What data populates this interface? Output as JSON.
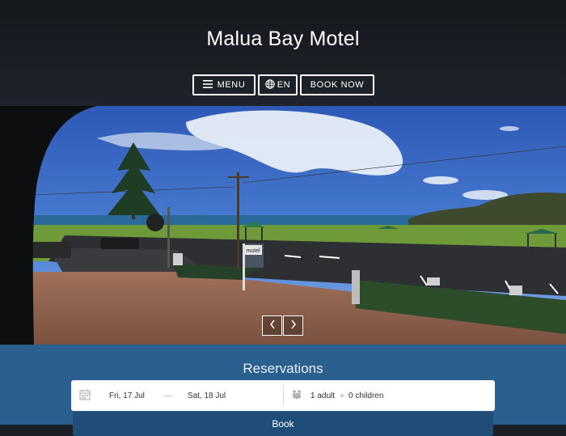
{
  "site": {
    "title": "Malua Bay Motel"
  },
  "nav": {
    "menu_label": "MENU",
    "language_label": "EN",
    "book_label": "BOOK NOW"
  },
  "hero": {
    "sign_text": "motel",
    "prev_icon": "chevron-left-icon",
    "next_icon": "chevron-right-icon"
  },
  "reservations": {
    "title": "Reservations",
    "check_in": "Fri, 17 Jul",
    "separator": "—",
    "check_out": "Sat, 18 Jul",
    "adults": "1 adult",
    "children": "0 children",
    "submit_label": "Book"
  },
  "colors": {
    "header_bg": "#1b1f26",
    "reservations_bg": "#2b5f8e",
    "button_bg": "#1f4d77"
  }
}
